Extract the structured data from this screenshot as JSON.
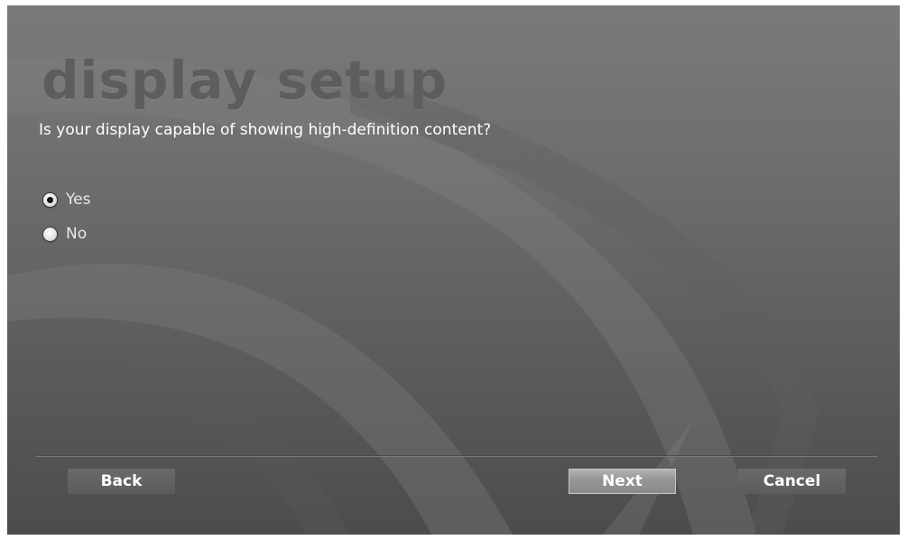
{
  "page": {
    "title": "display setup",
    "question": "Is your display capable of showing high-definition content?"
  },
  "options": [
    {
      "label": "Yes",
      "selected": true
    },
    {
      "label": "No",
      "selected": false
    }
  ],
  "buttons": {
    "back": "Back",
    "next": "Next",
    "cancel": "Cancel"
  },
  "colors": {
    "background": "#6c6c6c",
    "title": "#5d5d5d",
    "text": "#ffffff",
    "next_button": "#9a9a9a",
    "button": "#606060"
  }
}
